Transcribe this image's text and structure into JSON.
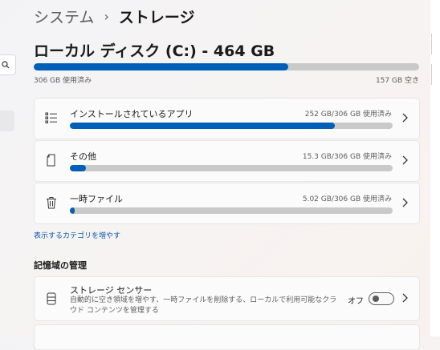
{
  "breadcrumb": {
    "parent": "システム",
    "separator": "›",
    "current": "ストレージ"
  },
  "disk": {
    "title": "ローカル ディスク (C:) - 464 GB",
    "used_label": "306 GB 使用済み",
    "free_label": "157 GB 空き",
    "used_fraction": 0.66
  },
  "categories": [
    {
      "label": "インストールされているアプリ",
      "amount": "252 GB/306 GB 使用済み",
      "fraction": 0.82,
      "icon": "app-list-icon"
    },
    {
      "label": "その他",
      "amount": "15.3 GB/306 GB 使用済み",
      "fraction": 0.05,
      "icon": "document-icon"
    },
    {
      "label": "一時ファイル",
      "amount": "5.02 GB/306 GB 使用済み",
      "fraction": 0.016,
      "icon": "trash-icon"
    }
  ],
  "more_link": "表示するカテゴリを増やす",
  "management": {
    "heading": "記憶域の管理",
    "storage_sense": {
      "title": "ストレージ センサー",
      "description": "自動的に空き領域を増やす、一時ファイルを削除する、ローカルで利用可能なクラウド コンテンツを管理する",
      "toggle_label": "オフ",
      "icon": "storage-drive-icon"
    }
  },
  "colors": {
    "accent": "#005fb8",
    "track": "#c9c9c9",
    "link": "#0a58a8"
  }
}
